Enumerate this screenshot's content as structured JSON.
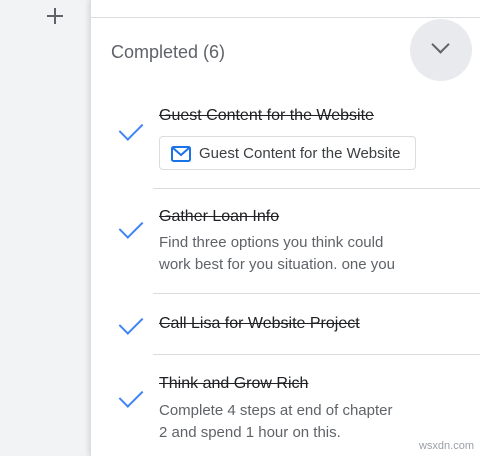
{
  "rail": {
    "add_icon": "plus-icon"
  },
  "completed_section": {
    "header": "Completed (6)",
    "collapse_icon": "chevron-down-icon",
    "tasks": [
      {
        "title": "Guest Content for the Website",
        "attachment": {
          "icon": "mail-icon",
          "label": "Guest Content for the Website"
        }
      },
      {
        "title": "Gather Loan Info",
        "notes_line1": "Find three options you think could",
        "notes_line2": "work best for you situation. one you"
      },
      {
        "title": "Call Lisa for Website Project"
      },
      {
        "title": "Think and Grow Rich",
        "notes_line1": "Complete 4 steps at end of chapter",
        "notes_line2": "2 and spend 1 hour on this."
      }
    ]
  },
  "colors": {
    "check": "#4285f4",
    "accent": "#1a73e8"
  },
  "watermark": "wsxdn.com"
}
